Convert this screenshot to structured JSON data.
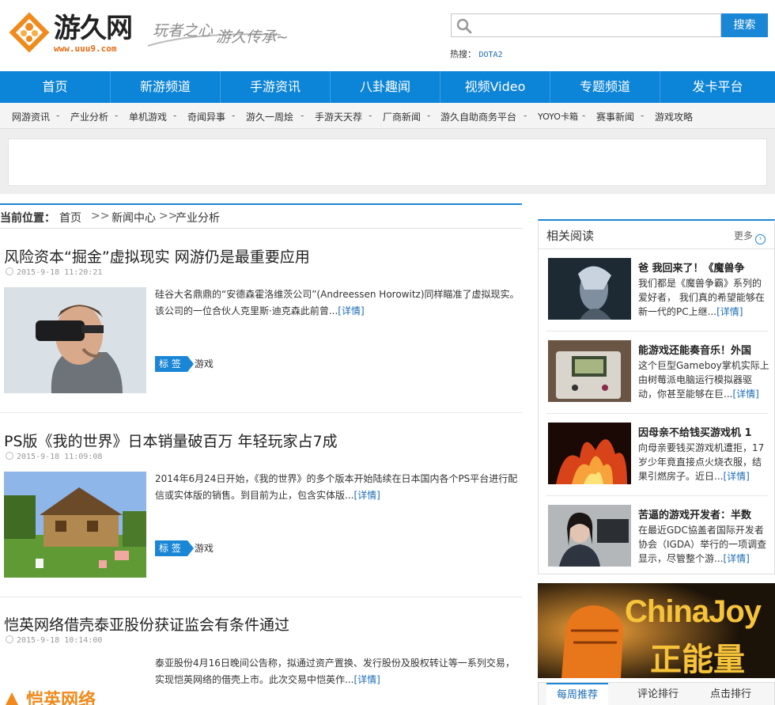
{
  "header": {
    "logo_text": "游久网",
    "logo_sub": "www.uuu9.com",
    "slogan_1": "玩者之心",
    "slogan_2": "游久传承~",
    "search_placeholder": "",
    "search_button": "搜索",
    "hot_label": "热搜：",
    "hot_link": "DOTA2"
  },
  "mainnav": [
    "首页",
    "新游频道",
    "手游资讯",
    "八卦趣闻",
    "视频Video",
    "专题频道",
    "发卡平台"
  ],
  "subnav": [
    "网游资讯",
    "产业分析",
    "单机游戏",
    "奇闻异事",
    "游久一周烩",
    "手游天天荐",
    "厂商新闻",
    "游久自助商务平台",
    "YOYO卡箱",
    "赛事新闻",
    "游戏攻略"
  ],
  "subnav_sep": "-",
  "breadcrumb": {
    "label": "当前位置：",
    "home": "首页",
    "sep1": ">>",
    "news": "新闻中心",
    "sep2": ">>",
    "current": "产业分析"
  },
  "articles": [
    {
      "title": "风险资本“掘金”虚拟现实 网游仍是最重要应用",
      "date": "2015-9-18 11:20:21",
      "summary": "硅谷大名鼎鼎的“安德森霍洛维茨公司”(Andreessen Horowitz)同样瞄准了虚拟现实。该公司的一位合伙人克里斯·迪克森此前曾...",
      "more": "[详情]",
      "tag_label": "标 签",
      "tag": "游戏"
    },
    {
      "title": "PS版《我的世界》日本销量破百万 年轻玩家占7成",
      "date": "2015-9-18 11:09:08",
      "summary": "2014年6月24日开始，《我的世界》的多个版本开始陆续在日本国内各个PS平台进行配信或实体版的销售。到目前为止，包含实体版...",
      "more": "[详情]",
      "tag_label": "标 签",
      "tag": "游戏"
    },
    {
      "title": "恺英网络借壳泰亚股份获证监会有条件通过",
      "date": "2015-9-18 10:14:00",
      "summary": "泰亚股份4月16日晚间公告称，拟通过资产置换、发行股份及股权转让等一系列交易，实现恺英网络的借壳上市。此次交易中恺英作...",
      "more": "[详情]",
      "thumb_text": "恺英网络"
    }
  ],
  "sidebar": {
    "title": "相关阅读",
    "more": "更多",
    "more_icon": "›",
    "items": [
      {
        "title": "爸 我回来了！《魔兽争",
        "summary": "我们都是《魔兽争霸》系列的爱好者， 我们真的希望能够在新一代的PC上继...",
        "more": "[详情]"
      },
      {
        "title": "能游戏还能奏音乐！外国",
        "summary": "这个巨型Gameboy掌机实际上由树莓派电脑运行模拟器驱动，你甚至能够在巨...",
        "more": "[详情]"
      },
      {
        "title": "因母亲不给钱买游戏机 1",
        "summary": "向母亲要钱买游戏机遭拒，17岁少年竟直接点火烧衣服，结果引燃房子。近日...",
        "more": "[详情]"
      },
      {
        "title": "苦逼的游戏开发者：半数",
        "summary": "在最近GDC協盖者国际开发者协会（IGDA）举行的一项调查显示，尽管整个游...",
        "more": "[详情]"
      }
    ]
  },
  "banner": {
    "line1": "ChinaJoy",
    "line2": "正能量"
  },
  "tabs": [
    "每周推荐",
    "评论排行",
    "点击排行"
  ],
  "colors": {
    "brand_blue": "#0c84d8",
    "logo_orange": "#f08a1c"
  }
}
